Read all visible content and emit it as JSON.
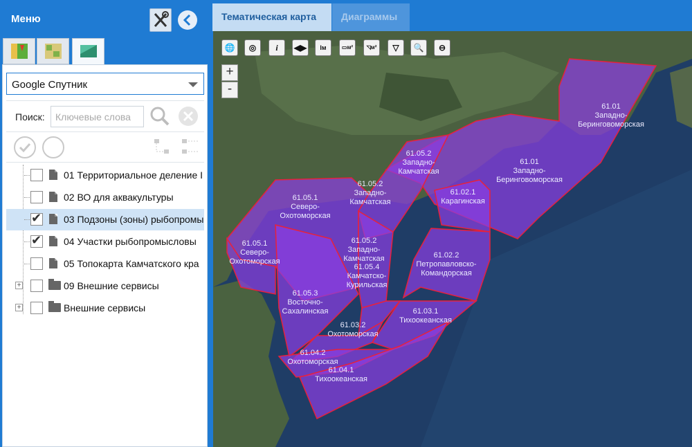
{
  "left_panel": {
    "title": "Меню",
    "tabs": [
      {
        "name": "map-icon"
      },
      {
        "name": "atlas-icon"
      },
      {
        "name": "layers-icon"
      }
    ],
    "basemap_select": {
      "value": "Google Спутник"
    },
    "search": {
      "label": "Поиск:",
      "placeholder": "Ключевые слова"
    },
    "tree": [
      {
        "label": "01 Территориальное деление I",
        "checked": false,
        "selected": false,
        "type": "doc"
      },
      {
        "label": "02 ВО для аквакультуры",
        "checked": false,
        "selected": false,
        "type": "doc"
      },
      {
        "label": "03 Подзоны (зоны) рыбопромы",
        "checked": true,
        "selected": true,
        "type": "doc"
      },
      {
        "label": "04 Участки рыбопромысловы",
        "checked": true,
        "selected": false,
        "type": "doc"
      },
      {
        "label": "05 Топокарта Камчатского кра",
        "checked": false,
        "selected": false,
        "type": "doc"
      },
      {
        "label": "09 Внешние сервисы",
        "checked": false,
        "selected": false,
        "type": "folder"
      },
      {
        "label": "Внешние сервисы",
        "checked": false,
        "selected": false,
        "type": "folder"
      }
    ]
  },
  "right_panel": {
    "tabs": [
      {
        "label": "Тематическая карта",
        "active": true
      },
      {
        "label": "Диаграммы",
        "active": false
      }
    ],
    "map_toolbar": [
      "globe-icon",
      "target-icon",
      "info-icon",
      "pan-icon",
      "measure-length-icon",
      "measure-area-icon",
      "measure-polygon-icon",
      "filter-icon",
      "zoom-out-area-icon",
      "zoom-reset-icon"
    ],
    "zoom": {
      "plus": "+",
      "minus": "-"
    },
    "zones": [
      {
        "code": "61.01",
        "name1": "Западно-",
        "name2": "Беринговоморская"
      },
      {
        "code": "61.01",
        "name1": "Западно-",
        "name2": "Беринговоморская"
      },
      {
        "code": "61.05.2",
        "name1": "Западно-",
        "name2": "Камчатская"
      },
      {
        "code": "61.02.1",
        "name1": "Карагинская",
        "name2": ""
      },
      {
        "code": "61.05.2",
        "name1": "Западно-",
        "name2": "Камчатская"
      },
      {
        "code": "61.05.1",
        "name1": "Северо-",
        "name2": "Охотоморская"
      },
      {
        "code": "61.05.1",
        "name1": "Северо-",
        "name2": "Охотоморская"
      },
      {
        "code": "61.05.2",
        "name1": "Западно-",
        "name2": "Камчатская"
      },
      {
        "code": "61.05.4",
        "name1": "Камчатско-",
        "name2": "Курильская"
      },
      {
        "code": "61.02.2",
        "name1": "Петропавловско-",
        "name2": "Командорская"
      },
      {
        "code": "61.05.3",
        "name1": "Восточно-",
        "name2": "Сахалинская"
      },
      {
        "code": "61.03.1",
        "name1": "Тихоокеанская",
        "name2": ""
      },
      {
        "code": "61.03.2",
        "name1": "Охотоморская",
        "name2": ""
      },
      {
        "code": "61.04.2",
        "name1": "Охотоморская",
        "name2": ""
      },
      {
        "code": "61.04.1",
        "name1": "Тихоокеанская",
        "name2": ""
      }
    ]
  },
  "colors": {
    "panel_blue": "#1f7bd3",
    "zone_fill": "#8a3de0",
    "zone_border": "#e8213b"
  }
}
